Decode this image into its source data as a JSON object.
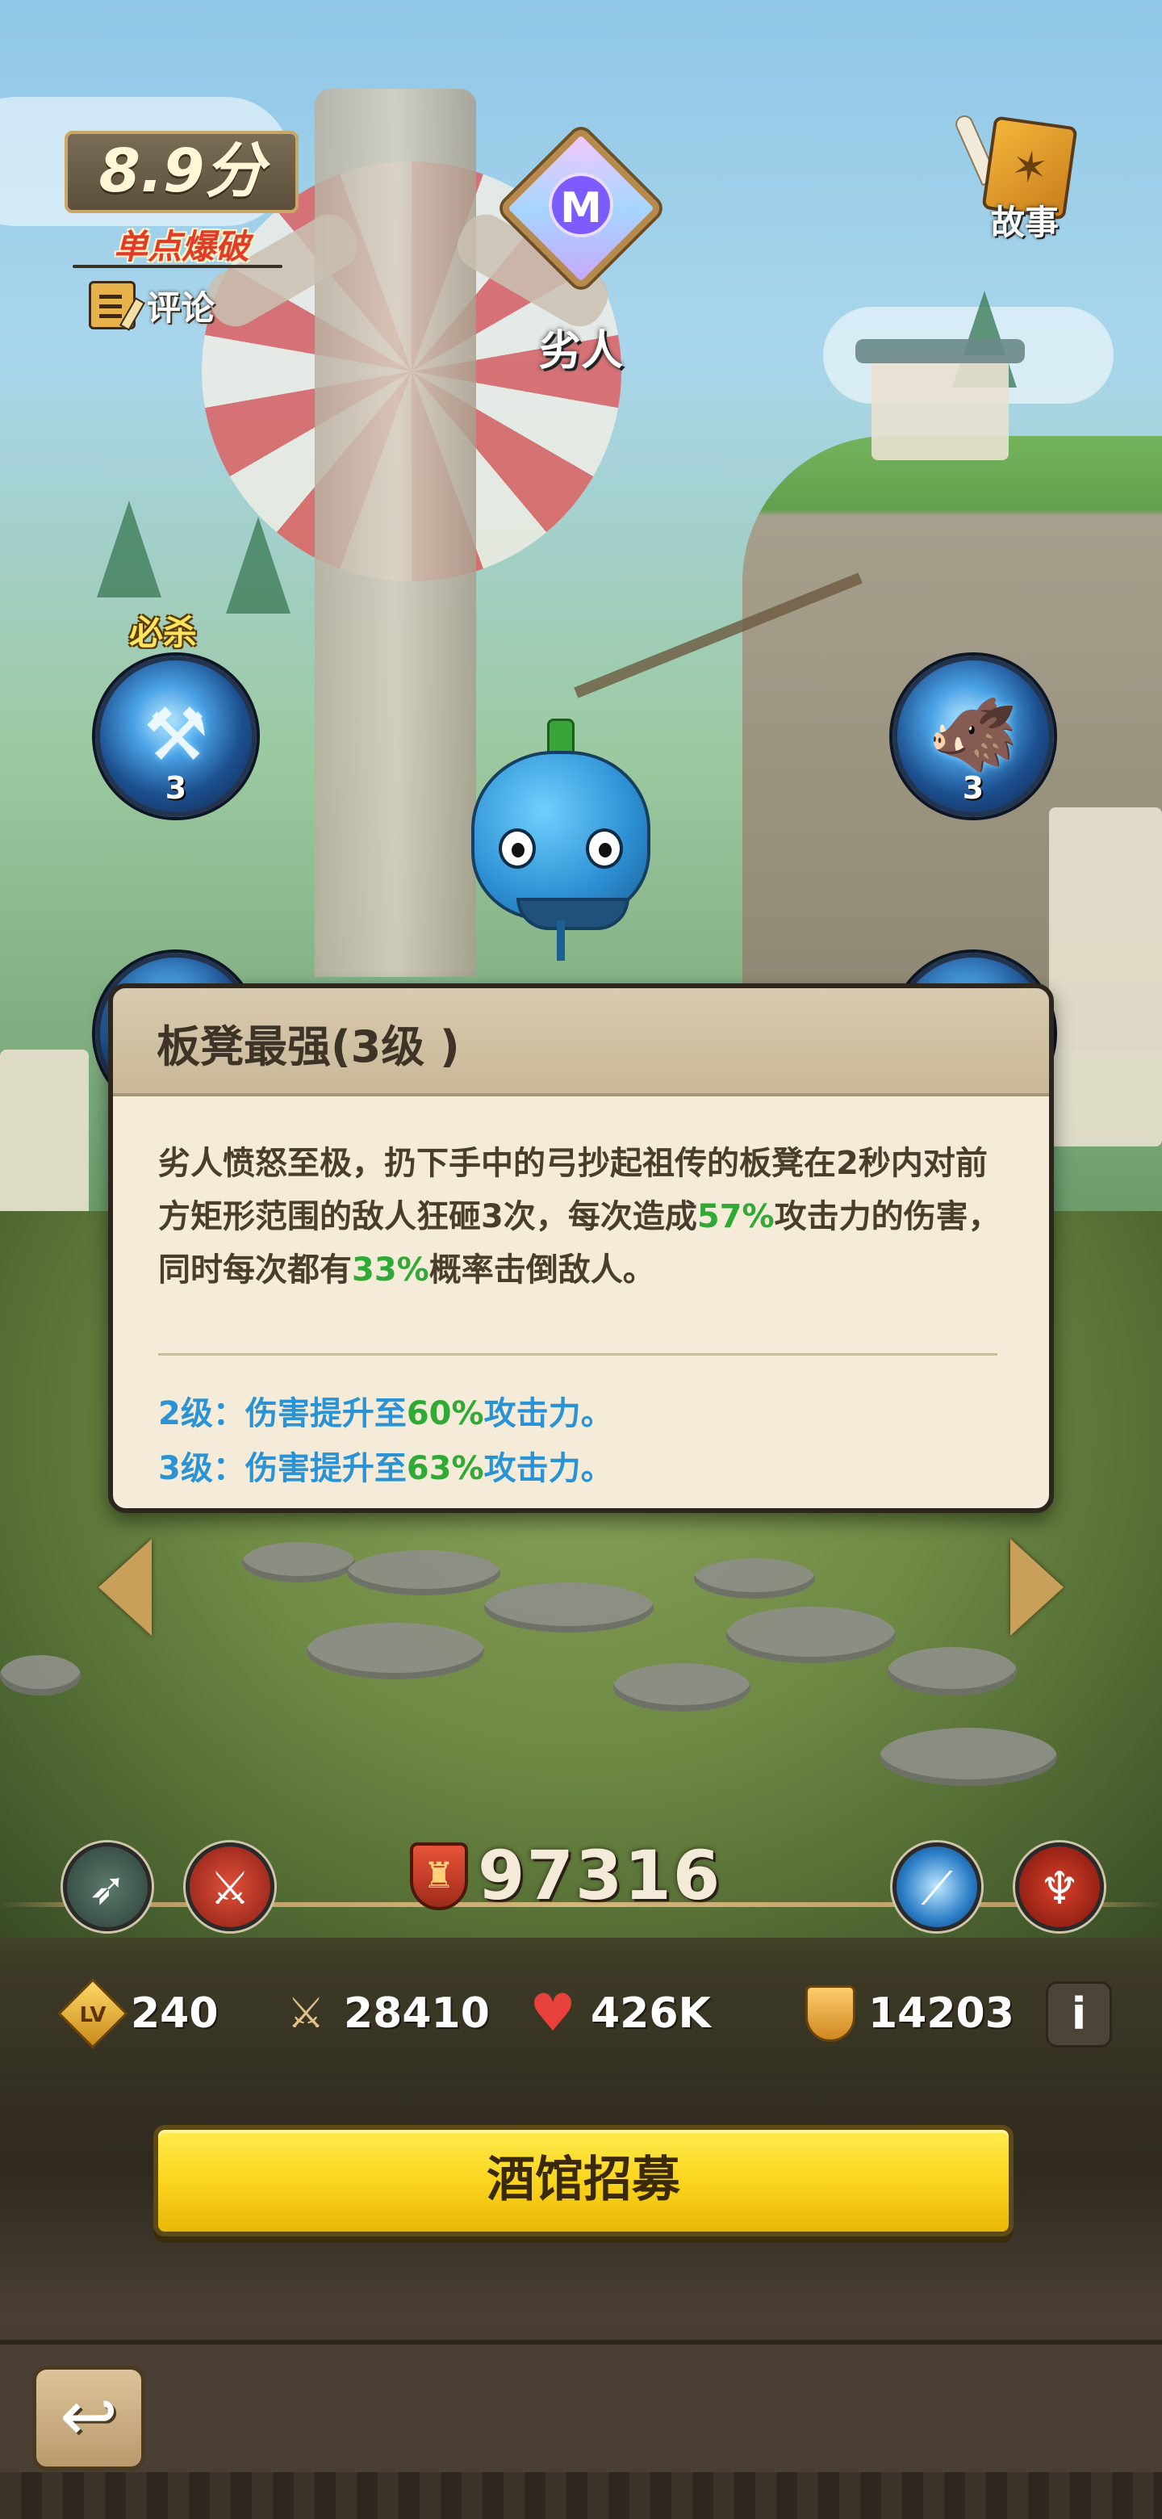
{
  "hud": {
    "score": "8.9分",
    "score_subtitle": "单点爆破",
    "comment_label": "评论",
    "rank_letter": "M",
    "hero_name": "劣人",
    "story_label": "故事"
  },
  "skills": {
    "ult_label": "必杀",
    "left_top_level": "3",
    "right_top_level": "3"
  },
  "tooltip": {
    "title": "板凳最强(3级 )",
    "desc_part1": "劣人愤怒至极，扔下手中的弓抄起祖传的板凳在2秒内对前方矩形范围的敌人狂砸3次，每次造成",
    "desc_hl1": "57%",
    "desc_part2": "攻击力的伤害，同时每次都有",
    "desc_hl2": "33%",
    "desc_part3": "概率击倒敌人。",
    "upgrade1_prefix": "2级：伤害提升至",
    "upgrade1_value": "60%",
    "upgrade1_suffix": "攻击力。",
    "upgrade2_prefix": "3级：伤害提升至",
    "upgrade2_value": "63%",
    "upgrade2_suffix": "攻击力。"
  },
  "power": {
    "value": "97316"
  },
  "stats": {
    "level": "240",
    "level_icon_text": "LV",
    "attack": "28410",
    "hp": "426K",
    "defense": "14203",
    "info_label": "i"
  },
  "actions": {
    "recruit_label": "酒馆招募"
  },
  "colors": {
    "highlight_green": "#2faa35",
    "upgrade_blue": "#2a93d6",
    "recruit_yellow": "#fbd51d"
  },
  "icons": {
    "comment": "note-pencil-icon",
    "story": "book-icon",
    "rank": "diamond-rank-icon",
    "power": "power-shield-icon",
    "level": "level-diamond-icon",
    "attack": "crossed-swords-icon",
    "hp": "heart-icon",
    "defense": "shield-icon",
    "back": "back-arrow-icon"
  }
}
